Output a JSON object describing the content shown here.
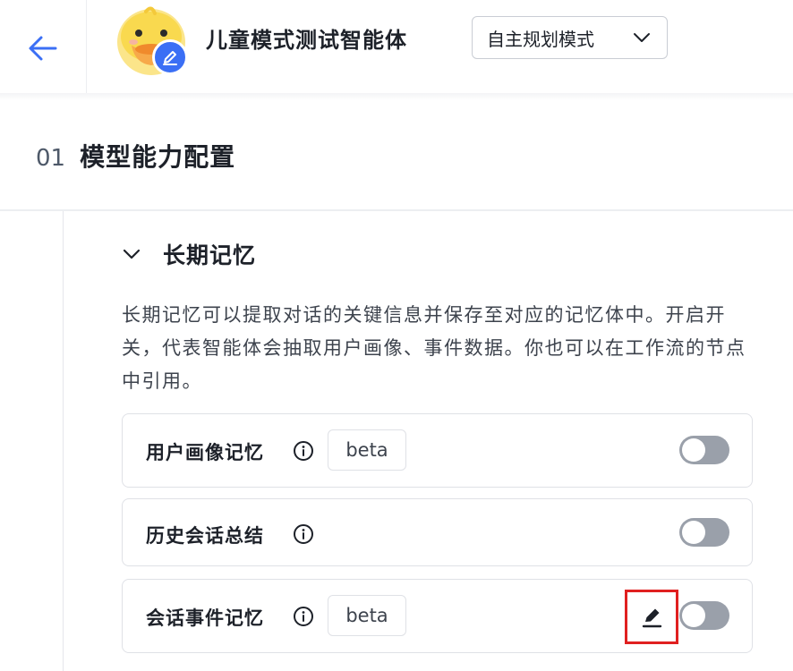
{
  "header": {
    "agent_name": "儿童模式测试智能体",
    "mode_select": {
      "selected": "自主规划模式"
    }
  },
  "section": {
    "number": "01",
    "title": "模型能力配置"
  },
  "memory": {
    "title": "长期记忆",
    "description": "长期记忆可以提取对话的关键信息并保存至对应的记忆体中。开启开关，代表智能体会抽取用户画像、事件数据。你也可以在工作流的节点中引用。",
    "items": [
      {
        "label": "用户画像记忆",
        "badge": "beta",
        "enabled": false
      },
      {
        "label": "历史会话总结",
        "enabled": false
      },
      {
        "label": "会话事件记忆",
        "badge": "beta",
        "enabled": false
      }
    ]
  },
  "colors": {
    "accent": "#3b6ff5",
    "toggle_off": "#9aa0aa",
    "highlight": "#e02020"
  }
}
